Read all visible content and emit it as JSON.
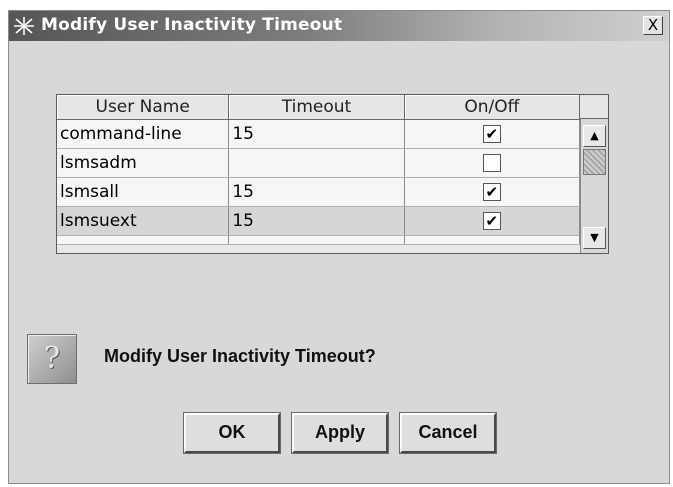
{
  "window": {
    "title": "Modify User Inactivity Timeout",
    "close_label": "X"
  },
  "table": {
    "columns": [
      "User Name",
      "Timeout",
      "On/Off"
    ],
    "rows": [
      {
        "user": "command-line",
        "timeout": "15",
        "checked": true
      },
      {
        "user": "lsmsadm",
        "timeout": "",
        "checked": false
      },
      {
        "user": "lsmsall",
        "timeout": "15",
        "checked": true
      },
      {
        "user": "lsmsuext",
        "timeout": "15",
        "checked": true
      }
    ],
    "check_glyph": "✔"
  },
  "scrollbar": {
    "up_glyph": "▲",
    "down_glyph": "▼"
  },
  "prompt": {
    "icon": "question-icon",
    "message": "Modify User Inactivity Timeout?"
  },
  "buttons": {
    "ok": "OK",
    "apply": "Apply",
    "cancel": "Cancel"
  }
}
